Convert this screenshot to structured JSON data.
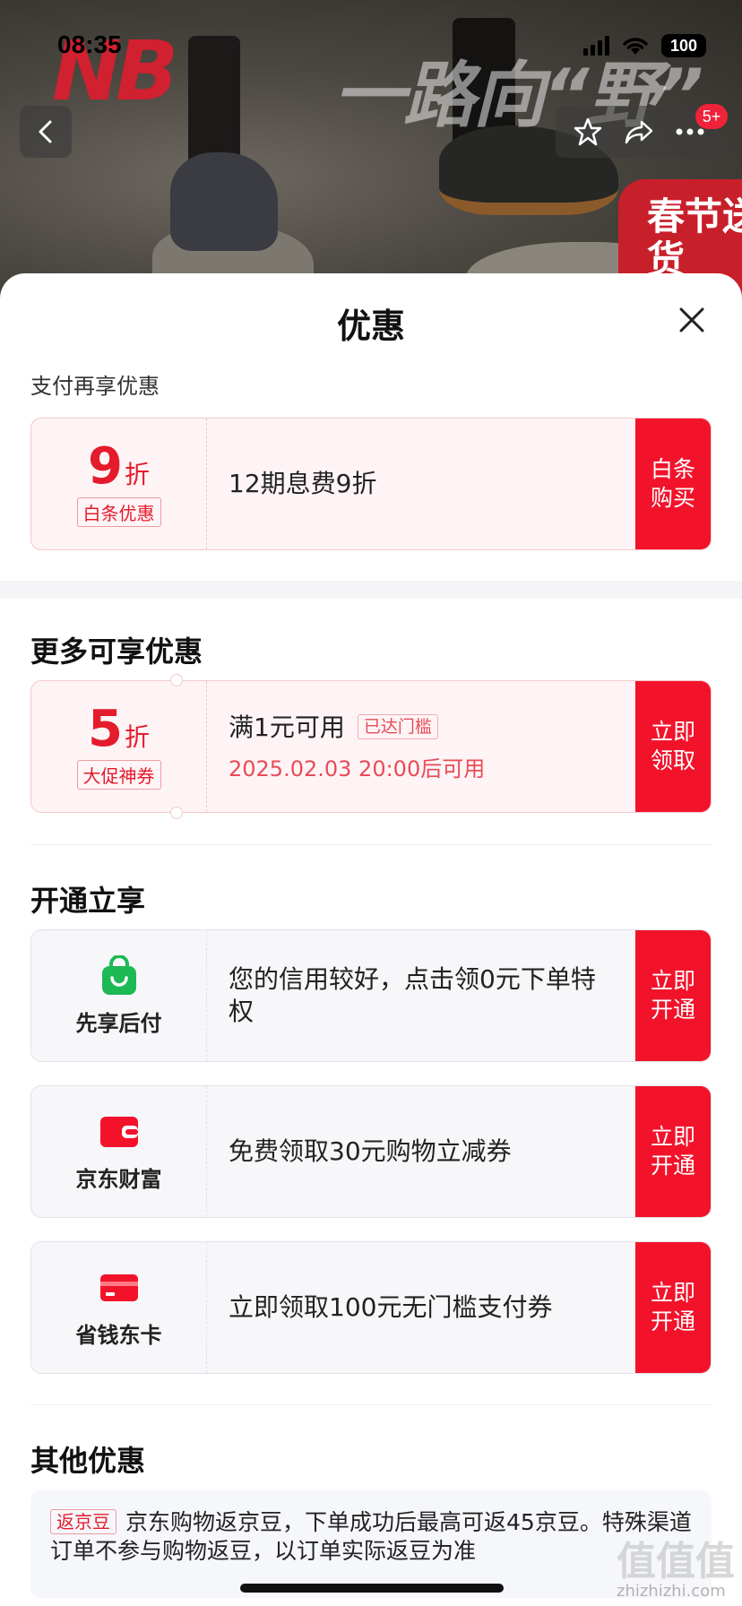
{
  "status_bar": {
    "time": "08:35",
    "battery": "100"
  },
  "hero": {
    "brand_logo": "NB",
    "slogan": "一路向“野”",
    "badge_text": "春节送货"
  },
  "nav": {
    "notification_count": "5+"
  },
  "sheet": {
    "title": "优惠",
    "pay_section_label": "支付再享优惠",
    "baitiao": {
      "discount_value": "9",
      "discount_unit": "折",
      "tag": "白条优惠",
      "text": "12期息费9折",
      "action": "白条购买"
    },
    "more_section_title": "更多可享优惠",
    "promo_coupon": {
      "discount_value": "5",
      "discount_unit": "折",
      "tag": "大促神券",
      "condition": "满1元可用",
      "reached_tag": "已达门槛",
      "available_time": "2025.02.03 20:00后可用",
      "action": "立即领取"
    },
    "open_section_title": "开通立享",
    "services": [
      {
        "name": "先享后付",
        "icon": "shopping-bag-icon",
        "text": "您的信用较好，点击领0元下单特权",
        "action": "立即开通"
      },
      {
        "name": "京东财富",
        "icon": "wallet-icon",
        "text": "免费领取30元购物立减券",
        "action": "立即开通"
      },
      {
        "name": "省钱东卡",
        "icon": "card-icon",
        "text": "立即领取100元无门槛支付券",
        "action": "立即开通"
      }
    ],
    "other_section_title": "其他优惠",
    "other_promo": {
      "tag": "返京豆",
      "text": "京东购物返京豆，下单成功后最高可返45京豆。特殊渠道订单不参与购物返豆，以订单实际返豆为准"
    }
  },
  "watermark": {
    "logo": "值值值",
    "site": "zhizhizhi.com"
  },
  "colors": {
    "accent_red": "#f2132b",
    "discount_red": "#e41b2c",
    "service_green": "#1db954"
  }
}
